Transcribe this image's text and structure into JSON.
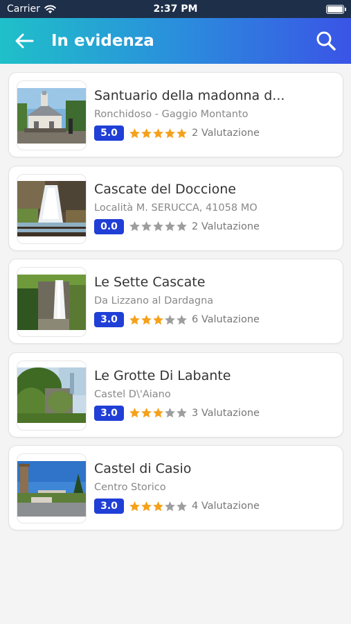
{
  "status_bar": {
    "carrier": "Carrier",
    "time": "2:37 PM"
  },
  "header": {
    "title": "In evidenza",
    "back_icon": "arrow-left-icon",
    "search_icon": "search-icon"
  },
  "colors": {
    "accent": "#1f3fd6",
    "star_filled": "#f5a11c",
    "star_empty": "#9e9e9e"
  },
  "items": [
    {
      "name": "Santuario della madonna d...",
      "address": "Ronchidoso - Gaggio Montanto",
      "score": "5.0",
      "stars": 5,
      "count_label": "2 Valutazione"
    },
    {
      "name": "Cascate del Doccione",
      "address": "Località M. SERUCCA, 41058 MO",
      "score": "0.0",
      "stars": 0,
      "count_label": "2 Valutazione"
    },
    {
      "name": "Le Sette Cascate",
      "address": "Da Lizzano al Dardagna",
      "score": "3.0",
      "stars": 3,
      "count_label": "6 Valutazione"
    },
    {
      "name": "Le Grotte Di Labante",
      "address": "Castel D\\'Aiano",
      "score": "3.0",
      "stars": 3,
      "count_label": "3 Valutazione"
    },
    {
      "name": "Castel di Casio",
      "address": "Centro Storico",
      "score": "3.0",
      "stars": 3,
      "count_label": "4 Valutazione"
    }
  ]
}
